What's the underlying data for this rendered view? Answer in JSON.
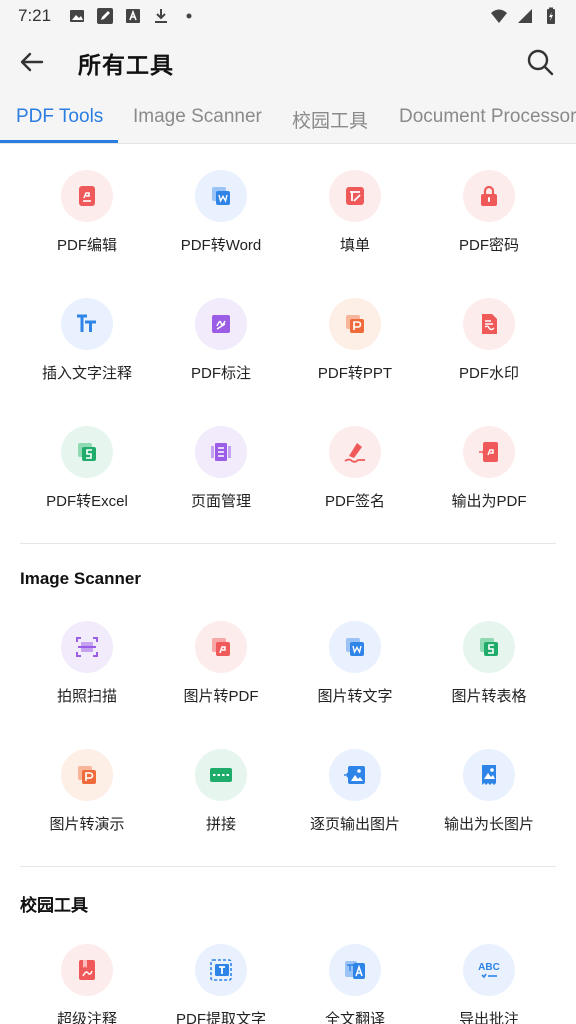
{
  "status_bar": {
    "time": "7:21"
  },
  "app_bar": {
    "title": "所有工具"
  },
  "tabs": [
    {
      "label": "PDF Tools"
    },
    {
      "label": "Image Scanner"
    },
    {
      "label": "校园工具"
    },
    {
      "label": "Document Processor"
    }
  ],
  "pdf_tools": [
    {
      "label": "PDF编辑",
      "icon": "pdf-edit-icon"
    },
    {
      "label": "PDF转Word",
      "icon": "pdf-to-word-icon"
    },
    {
      "label": "填单",
      "icon": "fill-form-icon"
    },
    {
      "label": "PDF密码",
      "icon": "lock-icon"
    },
    {
      "label": "插入文字注释",
      "icon": "text-insert-icon"
    },
    {
      "label": "PDF标注",
      "icon": "annotate-icon"
    },
    {
      "label": "PDF转PPT",
      "icon": "pdf-to-ppt-icon"
    },
    {
      "label": "PDF水印",
      "icon": "watermark-icon"
    },
    {
      "label": "PDF转Excel",
      "icon": "pdf-to-excel-icon"
    },
    {
      "label": "页面管理",
      "icon": "page-manage-icon"
    },
    {
      "label": "PDF签名",
      "icon": "signature-icon"
    },
    {
      "label": "输出为PDF",
      "icon": "export-pdf-icon"
    }
  ],
  "image_scanner": {
    "title": "Image Scanner",
    "items": [
      {
        "label": "拍照扫描",
        "icon": "scan-icon"
      },
      {
        "label": "图片转PDF",
        "icon": "image-to-pdf-icon"
      },
      {
        "label": "图片转文字",
        "icon": "image-to-text-icon"
      },
      {
        "label": "图片转表格",
        "icon": "image-to-sheet-icon"
      },
      {
        "label": "图片转演示",
        "icon": "image-to-ppt-icon"
      },
      {
        "label": "拼接",
        "icon": "stitch-icon"
      },
      {
        "label": "逐页输出图片",
        "icon": "export-images-icon"
      },
      {
        "label": "输出为长图片",
        "icon": "long-image-icon"
      }
    ]
  },
  "campus_tools": {
    "title": "校园工具",
    "items": [
      {
        "label": "超级注释",
        "icon": "super-annotate-icon"
      },
      {
        "label": "PDF提取文字",
        "icon": "extract-text-icon"
      },
      {
        "label": "全文翻译",
        "icon": "translate-icon"
      },
      {
        "label": "导出批注",
        "icon": "spellcheck-icon"
      }
    ]
  }
}
